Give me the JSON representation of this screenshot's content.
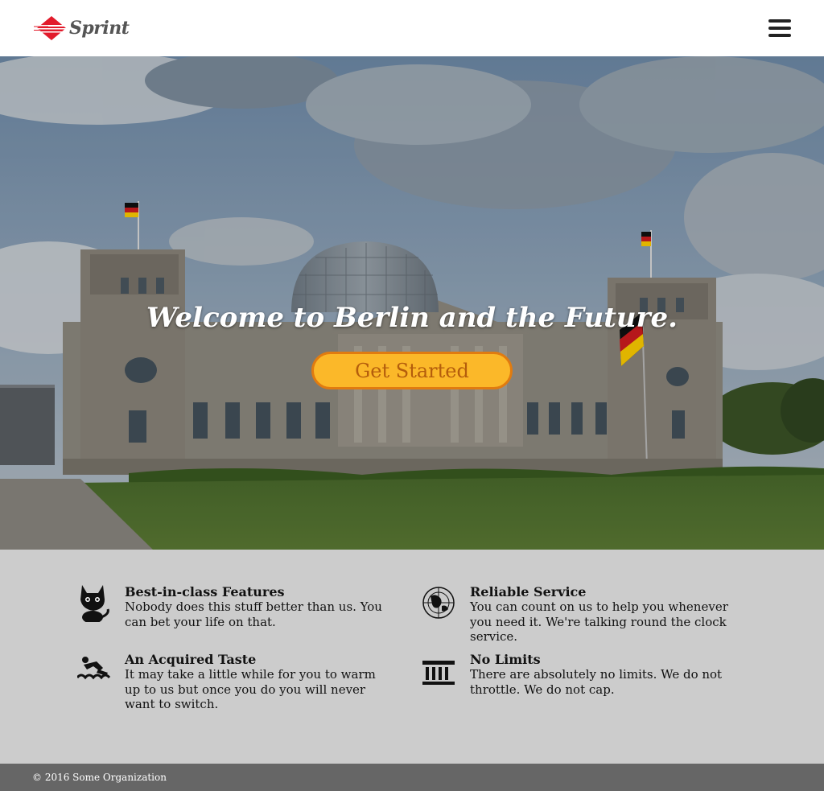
{
  "header": {
    "logo_text": "Sprint",
    "menu_icon": "hamburger-menu-icon"
  },
  "hero": {
    "title": "Welcome to Berlin and the Future.",
    "cta_label": "Get Started",
    "background": "reichstag-building-photo"
  },
  "features": [
    {
      "icon": "cat-icon",
      "title": "Best-in-class Features",
      "description": "Nobody does this stuff better than us. You can bet your life on that."
    },
    {
      "icon": "globe-icon",
      "title": "Reliable Service",
      "description": "You can count on us to help you whenever you need it. We're talking round the clock service."
    },
    {
      "icon": "swimmer-icon",
      "title": "An Acquired Taste",
      "description": "It may take a little while for you to warm up to us but once you do you will never want to switch."
    },
    {
      "icon": "columns-building-icon",
      "title": "No Limits",
      "description": "There are absolutely no limits. We do not throttle. We do not cap."
    }
  ],
  "footer": {
    "copyright": "© 2016 Some Organization"
  },
  "colors": {
    "cta_fill": "#fbb829",
    "cta_border": "#e07b10",
    "cta_text": "#b45d0c",
    "features_bg": "#cccccc",
    "footer_bg": "#666666",
    "logo_red": "#e21b2b"
  }
}
